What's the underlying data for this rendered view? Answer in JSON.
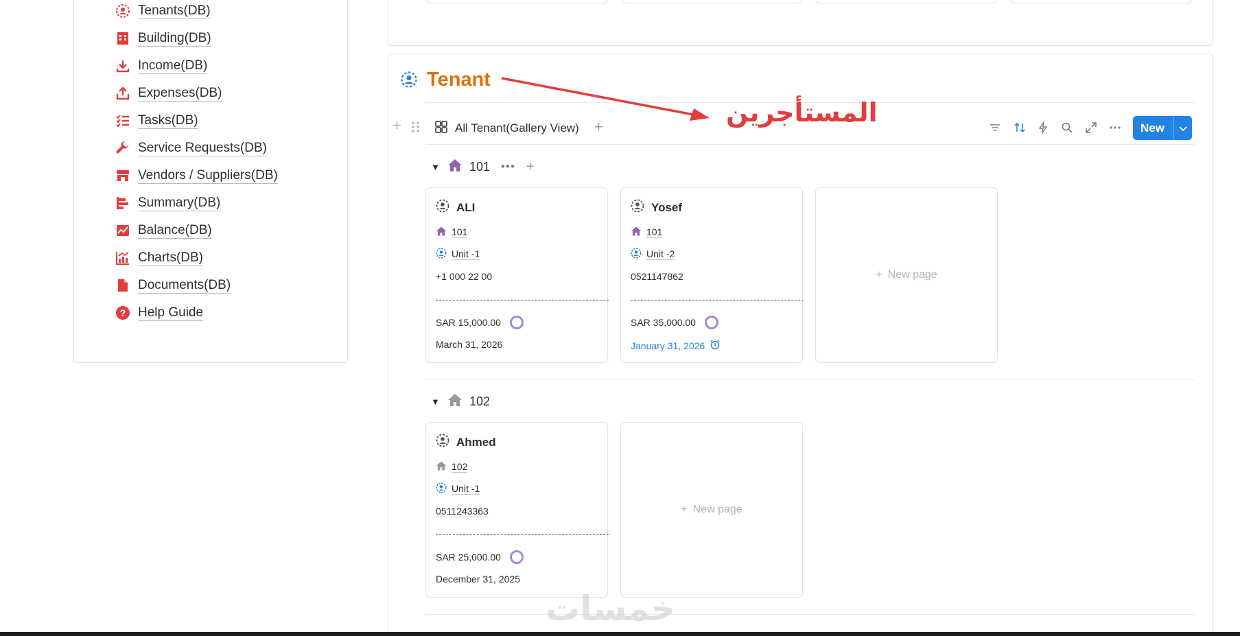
{
  "sidebar": {
    "items": [
      {
        "label": "Tenants(DB)",
        "icon": "tenant-icon"
      },
      {
        "label": "Building(DB)",
        "icon": "building-icon"
      },
      {
        "label": "Income(DB)",
        "icon": "download-icon"
      },
      {
        "label": "Expenses(DB)",
        "icon": "upload-icon"
      },
      {
        "label": "Tasks(DB)",
        "icon": "checklist-icon"
      },
      {
        "label": "Service Requests(DB)",
        "icon": "wrench-icon"
      },
      {
        "label": "Vendors / Suppliers(DB)",
        "icon": "store-icon"
      },
      {
        "label": "Summary(DB)",
        "icon": "bar-chart-icon"
      },
      {
        "label": "Balance(DB)",
        "icon": "line-chart-icon"
      },
      {
        "label": "Charts(DB)",
        "icon": "combo-chart-icon"
      },
      {
        "label": "Documents(DB)",
        "icon": "document-icon"
      },
      {
        "label": "Help Guide",
        "icon": "help-icon"
      }
    ],
    "icon_color": "#e03e3e"
  },
  "section": {
    "title": "Tenant",
    "title_color": "#d9730d",
    "annotation": "المستأجرين",
    "annotation_color": "#e03e3e"
  },
  "toolbar": {
    "view_label": "All Tenant(Gallery View)",
    "new_label": "New",
    "accent": "#2383e2"
  },
  "groups": [
    {
      "label": "101",
      "cards": [
        {
          "name": "ALI",
          "unit_ref": "101",
          "unit": "Unit -1",
          "phone": "+1 000 22 00",
          "amount": "SAR 15,000.00",
          "date": "March 31, 2026",
          "date_overdue": false
        },
        {
          "name": "Yosef",
          "unit_ref": "101",
          "unit": "Unit -2",
          "phone": "0521147862",
          "amount": "SAR 35,000.00",
          "date": "January 31, 2026",
          "date_overdue": true
        }
      ],
      "new_page_label": "New page"
    },
    {
      "label": "102",
      "cards": [
        {
          "name": "Ahmed",
          "unit_ref": "102",
          "unit": "Unit -1",
          "phone": "0511243363",
          "amount": "SAR 25,000.00",
          "date": "December 31, 2025",
          "date_overdue": false
        }
      ],
      "new_page_label": "New page"
    }
  ],
  "watermark": "خمسات"
}
